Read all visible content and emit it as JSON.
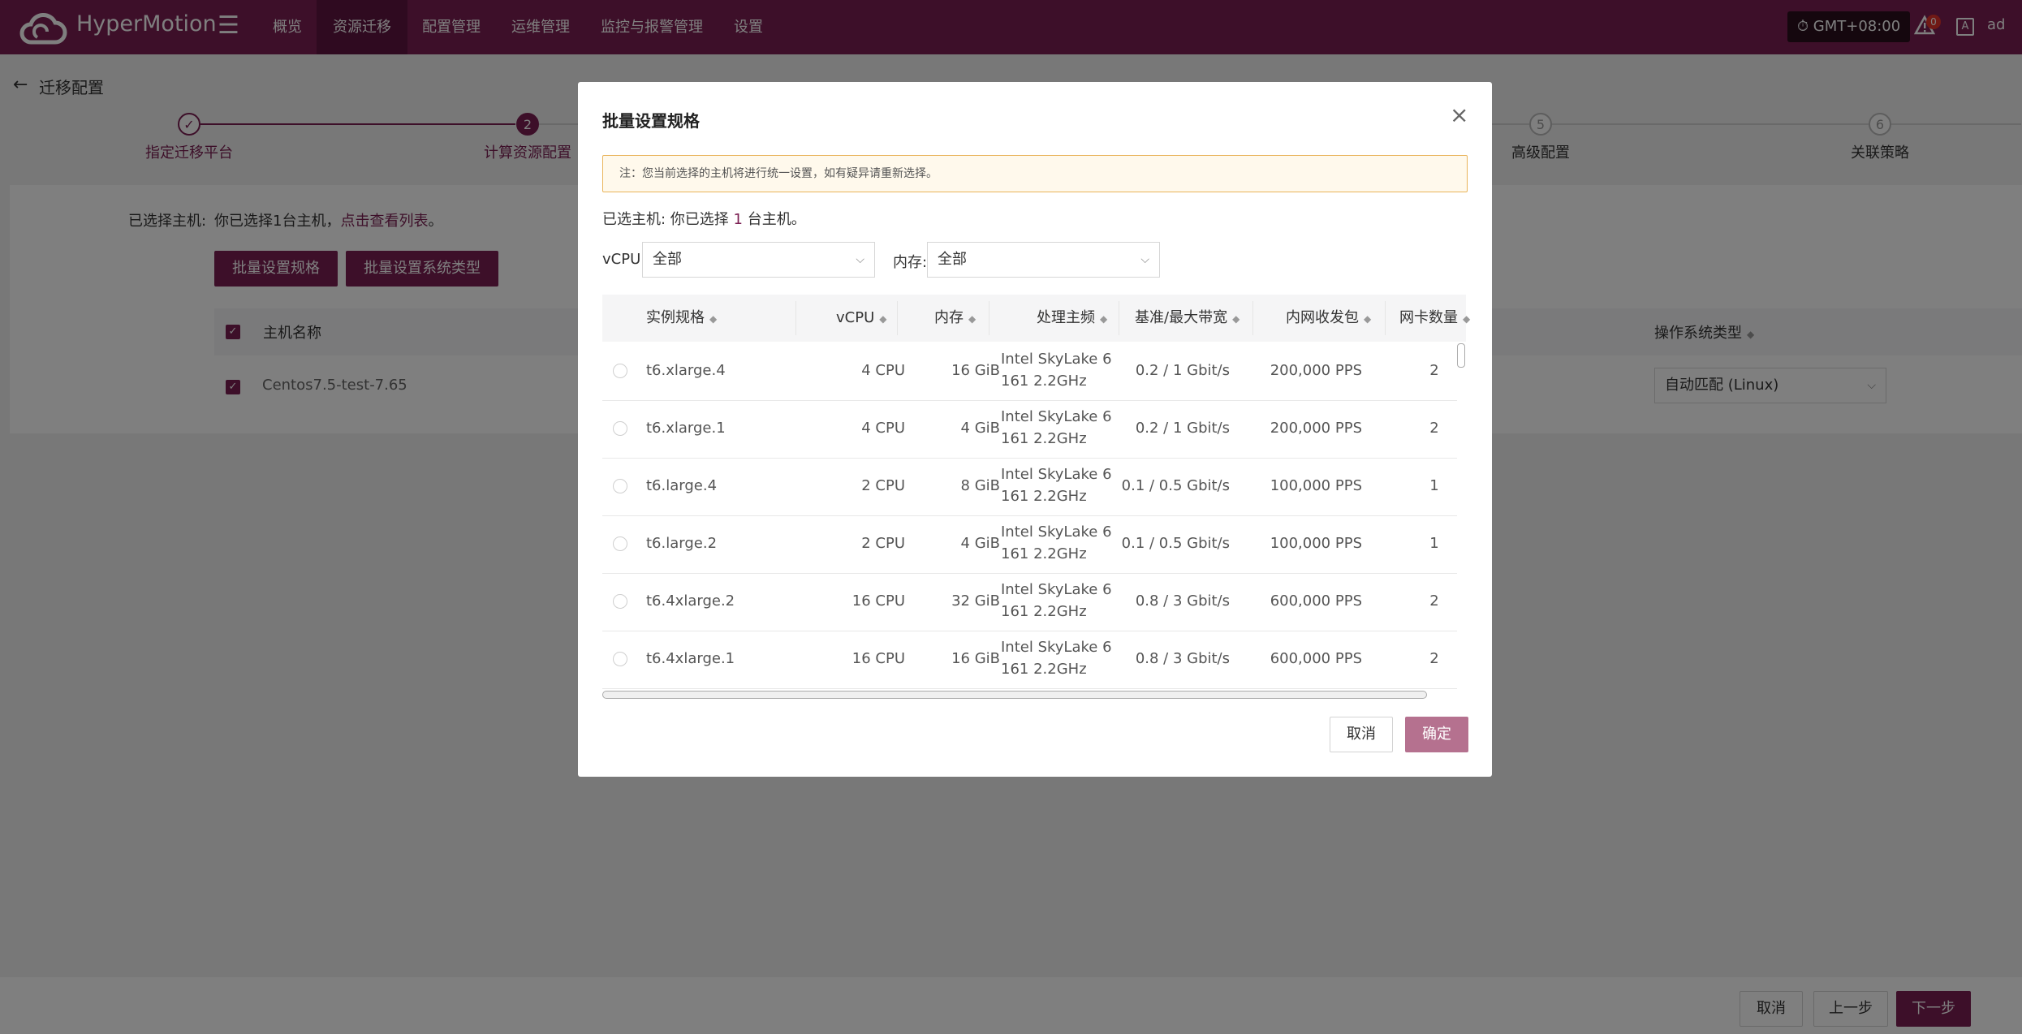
{
  "app": {
    "brand": "HyperMotion",
    "timezone": "GMT+08:00",
    "alert_count": "0",
    "user": "ad",
    "lang_icon": "A"
  },
  "nav": {
    "items": [
      "概览",
      "资源迁移",
      "配置管理",
      "运维管理",
      "监控与报警管理",
      "设置"
    ],
    "active": "资源迁移"
  },
  "page": {
    "title": "迁移配置",
    "steps": [
      {
        "num": "✓",
        "label": "指定迁移平台",
        "state": "done"
      },
      {
        "num": "2",
        "label": "计算资源配置",
        "state": "current"
      },
      {
        "num": "5",
        "label": "高级配置",
        "state": "todo"
      },
      {
        "num": "6",
        "label": "关联策略",
        "state": "todo"
      }
    ],
    "selected_label": "已选择主机:",
    "selected_text_pre": "你已选择1台主机，",
    "selected_link": "点击查看列表",
    "selected_text_post": "。",
    "btn_batch_spec": "批量设置规格",
    "btn_batch_os": "批量设置系统类型",
    "table": {
      "col_name": "主机名称",
      "col_os": "操作系统类型",
      "row_name": "Centos7.5-test-7.65",
      "row_os": "自动匹配 (Linux)"
    },
    "footer": {
      "cancel": "取消",
      "prev": "上一步",
      "next": "下一步"
    }
  },
  "modal": {
    "title": "批量设置规格",
    "note": "注：您当前选择的主机将进行统一设置，如有疑异请重新选择。",
    "selected_pre": "已选主机: 你已选择 ",
    "selected_count": "1",
    "selected_post": " 台主机。",
    "vcpu_label": "vCPU:",
    "vcpu_value": "全部",
    "mem_label": "内存:",
    "mem_value": "全部",
    "columns": [
      "实例规格",
      "vCPU",
      "内存",
      "处理主频",
      "基准/最大带宽",
      "内网收发包",
      "网卡数量"
    ],
    "rows": [
      {
        "spec": "t6.xlarge.4",
        "vcpu": "4 CPU",
        "mem": "16 GiB",
        "cpu1": "Intel SkyLake 6",
        "cpu2": "161 2.2GHz",
        "bw": "0.2 / 1 Gbit/s",
        "pps": "200,000 PPS",
        "nic": "2"
      },
      {
        "spec": "t6.xlarge.1",
        "vcpu": "4 CPU",
        "mem": "4 GiB",
        "cpu1": "Intel SkyLake 6",
        "cpu2": "161 2.2GHz",
        "bw": "0.2 / 1 Gbit/s",
        "pps": "200,000 PPS",
        "nic": "2"
      },
      {
        "spec": "t6.large.4",
        "vcpu": "2 CPU",
        "mem": "8 GiB",
        "cpu1": "Intel SkyLake 6",
        "cpu2": "161 2.2GHz",
        "bw": "0.1 / 0.5 Gbit/s",
        "pps": "100,000 PPS",
        "nic": "1"
      },
      {
        "spec": "t6.large.2",
        "vcpu": "2 CPU",
        "mem": "4 GiB",
        "cpu1": "Intel SkyLake 6",
        "cpu2": "161 2.2GHz",
        "bw": "0.1 / 0.5 Gbit/s",
        "pps": "100,000 PPS",
        "nic": "1"
      },
      {
        "spec": "t6.4xlarge.2",
        "vcpu": "16 CPU",
        "mem": "32 GiB",
        "cpu1": "Intel SkyLake 6",
        "cpu2": "161 2.2GHz",
        "bw": "0.8 / 3 Gbit/s",
        "pps": "600,000 PPS",
        "nic": "2"
      },
      {
        "spec": "t6.4xlarge.1",
        "vcpu": "16 CPU",
        "mem": "16 GiB",
        "cpu1": "Intel SkyLake 6",
        "cpu2": "161 2.2GHz",
        "bw": "0.8 / 3 Gbit/s",
        "pps": "600,000 PPS",
        "nic": "2"
      }
    ],
    "cancel": "取消",
    "ok": "确定"
  },
  "colors": {
    "brand": "#7b1e52",
    "brand_dark": "#5e1540",
    "ok_disabled": "#b5718f"
  }
}
